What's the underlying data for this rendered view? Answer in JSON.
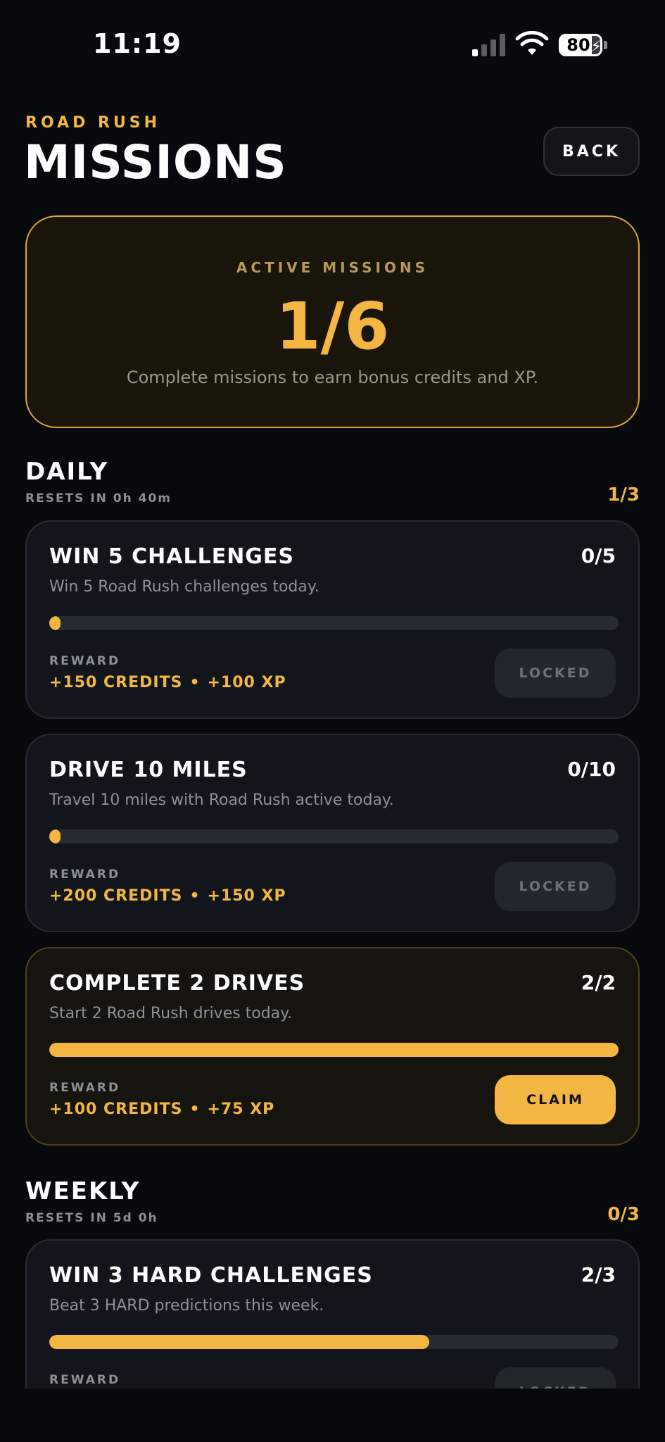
{
  "status_bar": {
    "time": "11:19",
    "battery": "80"
  },
  "header": {
    "brand": "ROAD RUSH",
    "title": "MISSIONS",
    "back_label": "BACK"
  },
  "summary": {
    "label": "ACTIVE MISSIONS",
    "count": "1/6",
    "description": "Complete missions to earn bonus credits and XP."
  },
  "daily": {
    "title": "DAILY",
    "reset": "RESETS IN 0h 40m",
    "count": "1/3",
    "missions": [
      {
        "title": "WIN 5 CHALLENGES",
        "progress": "0/5",
        "progress_value": 0,
        "description": "Win 5 Road Rush challenges today.",
        "reward_label": "REWARD",
        "credits": "+150 CREDITS",
        "xp": "+100 XP",
        "action": "LOCKED"
      },
      {
        "title": "DRIVE 10 MILES",
        "progress": "0/10",
        "progress_value": 0,
        "description": "Travel 10 miles with Road Rush active today.",
        "reward_label": "REWARD",
        "credits": "+200 CREDITS",
        "xp": "+150 XP",
        "action": "LOCKED"
      },
      {
        "title": "COMPLETE 2 DRIVES",
        "progress": "2/2",
        "progress_value": 1,
        "description": "Start 2 Road Rush drives today.",
        "reward_label": "REWARD",
        "credits": "+100 CREDITS",
        "xp": "+75 XP",
        "action": "CLAIM"
      }
    ]
  },
  "weekly": {
    "title": "WEEKLY",
    "reset": "RESETS IN 5d 0h",
    "count": "0/3",
    "missions": [
      {
        "title": "WIN 3 HARD CHALLENGES",
        "progress": "2/3",
        "progress_value": 0.667,
        "description": "Beat 3 HARD predictions this week.",
        "reward_label": "REWARD",
        "action": "LOCKED"
      }
    ]
  },
  "colors": {
    "accent": "#f4b642",
    "background": "#07090c",
    "card": "#12161c"
  }
}
